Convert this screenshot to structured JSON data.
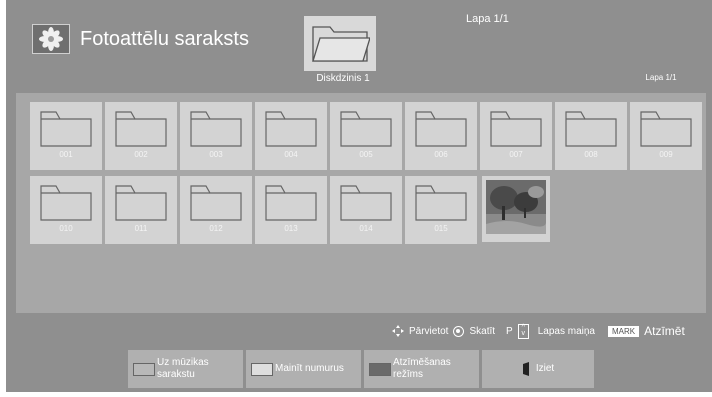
{
  "header": {
    "title": "Fotoattēlu saraksts",
    "page_top": "Lapa 1/1",
    "drive_label": "Diskdzinis 1",
    "page_right": "Lapa 1/1"
  },
  "folders": [
    "001",
    "002",
    "003",
    "004",
    "005",
    "006",
    "007",
    "008",
    "009",
    "010",
    "011",
    "012",
    "013",
    "014",
    "015"
  ],
  "hints": {
    "move": "Pārvietot",
    "view": "Skatīt",
    "page_key": "P",
    "page_change": "Lapas maiņa",
    "mark_key": "MARK",
    "mark_label": "Atzīmēt"
  },
  "footer": {
    "music_list": "Uz mūzikas sarakstu",
    "change_numbers": "Mainīt numurus",
    "mark_mode": "Atzīmēšanas režīms",
    "exit": "Iziet"
  },
  "colors": {
    "background": "#8f8f8f",
    "content_area": "#a7a7a7",
    "tile": "#d3d3d3",
    "footer_button": "#b0b0b0",
    "swatch_green": "#b8b8b8",
    "swatch_yellow": "#dedede",
    "swatch_blue": "#6a6a6a"
  },
  "icons": [
    "photo-app-icon",
    "folder-icon",
    "navigate-icon",
    "ok-icon",
    "page-updown-icon",
    "exit-icon"
  ]
}
